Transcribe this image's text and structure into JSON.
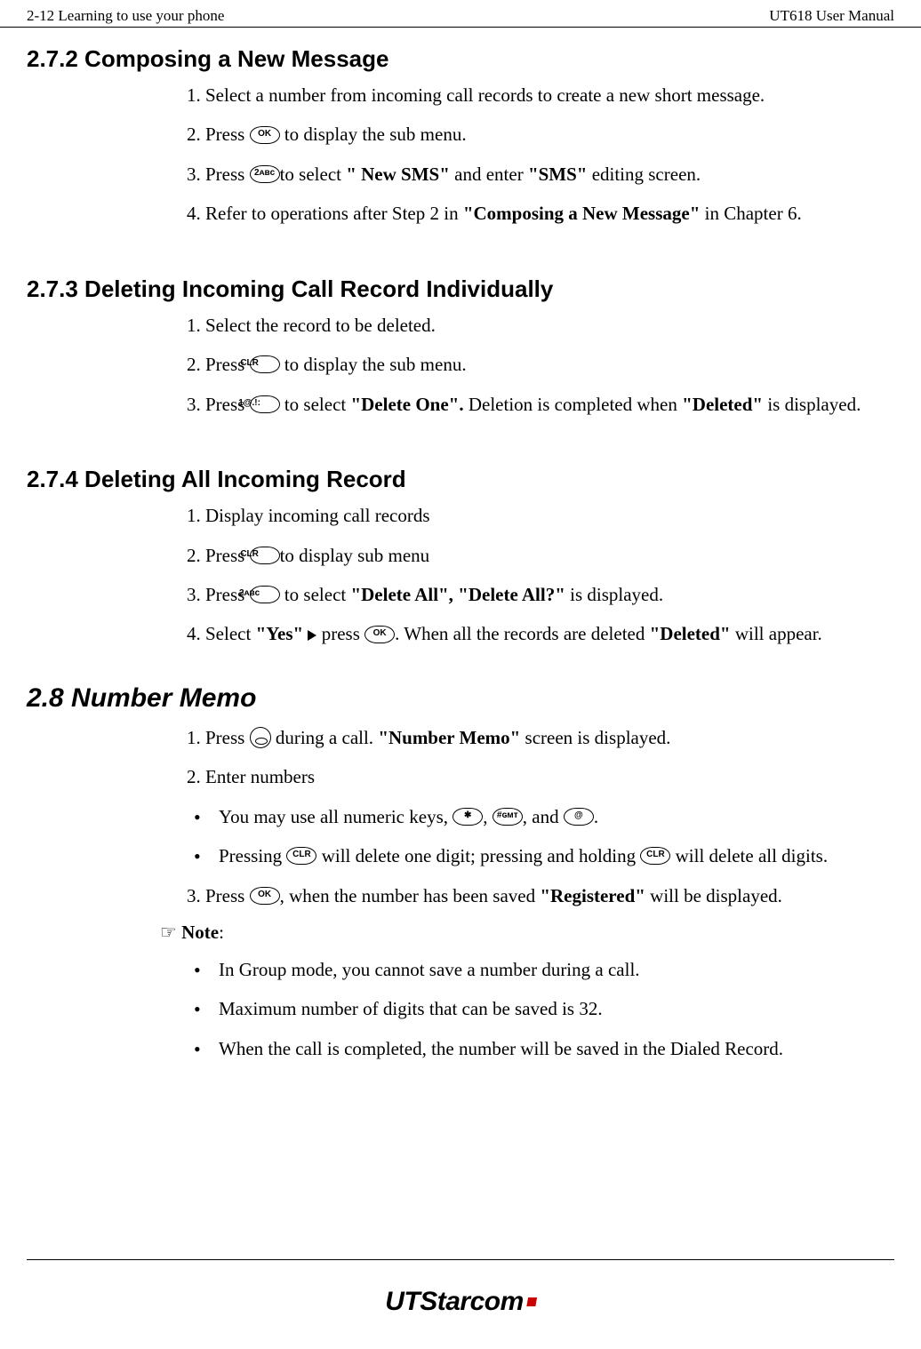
{
  "header": {
    "left": "2-12   Learning to use your phone",
    "right": "UT618 User Manual"
  },
  "s272": {
    "title": "2.7.2 Composing a New Message",
    "step1": "1. Select a number from incoming call records to create a new short message.",
    "step2a": "2. Press ",
    "step2b": " to display the sub menu.",
    "step3a": "3. Press ",
    "step3b": "to select ",
    "step3c": "\" New SMS\"",
    "step3d": " and enter ",
    "step3e": "\"SMS\"",
    "step3f": " editing screen.",
    "step4a": "4. Refer to operations after Step 2 in ",
    "step4b": "\"Composing a New Message\"",
    "step4c": " in Chapter 6."
  },
  "s273": {
    "title": "2.7.3 Deleting Incoming Call Record Individually",
    "step1": "1.   Select the record to be deleted.",
    "step2a": "2.   Press ",
    "step2b": " to display the sub menu.",
    "step3a": "3.   Press ",
    "step3b": " to select ",
    "step3c": "\"Delete One\".",
    "step3d": " Deletion is completed when ",
    "step3e": "\"Deleted\"",
    "step3f": " is displayed."
  },
  "s274": {
    "title": "2.7.4 Deleting All Incoming Record",
    "step1": "1.   Display incoming call records",
    "step2a": "2.   Press ",
    "step2b": "to display sub menu",
    "step3a": "3.   Press ",
    "step3b": " to select ",
    "step3c": "\"Delete All\", \"Delete All?\"",
    "step3d": " is displayed.",
    "step4a": "4. Select ",
    "step4b": "\"Yes\"",
    "step4c": " press ",
    "step4d": ". When all the records are deleted ",
    "step4e": "\"Deleted\"",
    "step4f": " will appear."
  },
  "s28": {
    "title": "2.8   Number Memo",
    "step1a": "1.   Press ",
    "step1b": "during a call. ",
    "step1c": "\"Number Memo\"",
    "step1d": " screen is displayed.",
    "step2": "2.   Enter numbers",
    "b1a": "You may use all numeric keys, ",
    "b1b": ", ",
    "b1c": ", and ",
    "b1d": ".",
    "b2a": "Pressing ",
    "b2b": " will delete one digit; pressing and holding ",
    "b2c": " will delete all digits.",
    "step3a": "3. Press ",
    "step3b": ", when the number has been saved  ",
    "step3c": "\"Registered\"",
    "step3d": " will be displayed.",
    "note_symbol": "☞ ",
    "note_label": "Note",
    "note_colon": ":",
    "n1": "In Group mode, you cannot save a number during a call.",
    "n2": "Maximum number of digits that can be saved is 32.",
    "n3": "When the call is completed, the number will be saved in the Dialed Record."
  },
  "keys": {
    "ok": "OK",
    "clr": "CLR",
    "two": "2ᴀʙᴄ",
    "one": "1@.!:",
    "star": "✱",
    "hash": "#ɢᴍᴛ",
    "at": "@"
  },
  "logo": {
    "ut": "UT",
    "starcom": "Starcom"
  }
}
